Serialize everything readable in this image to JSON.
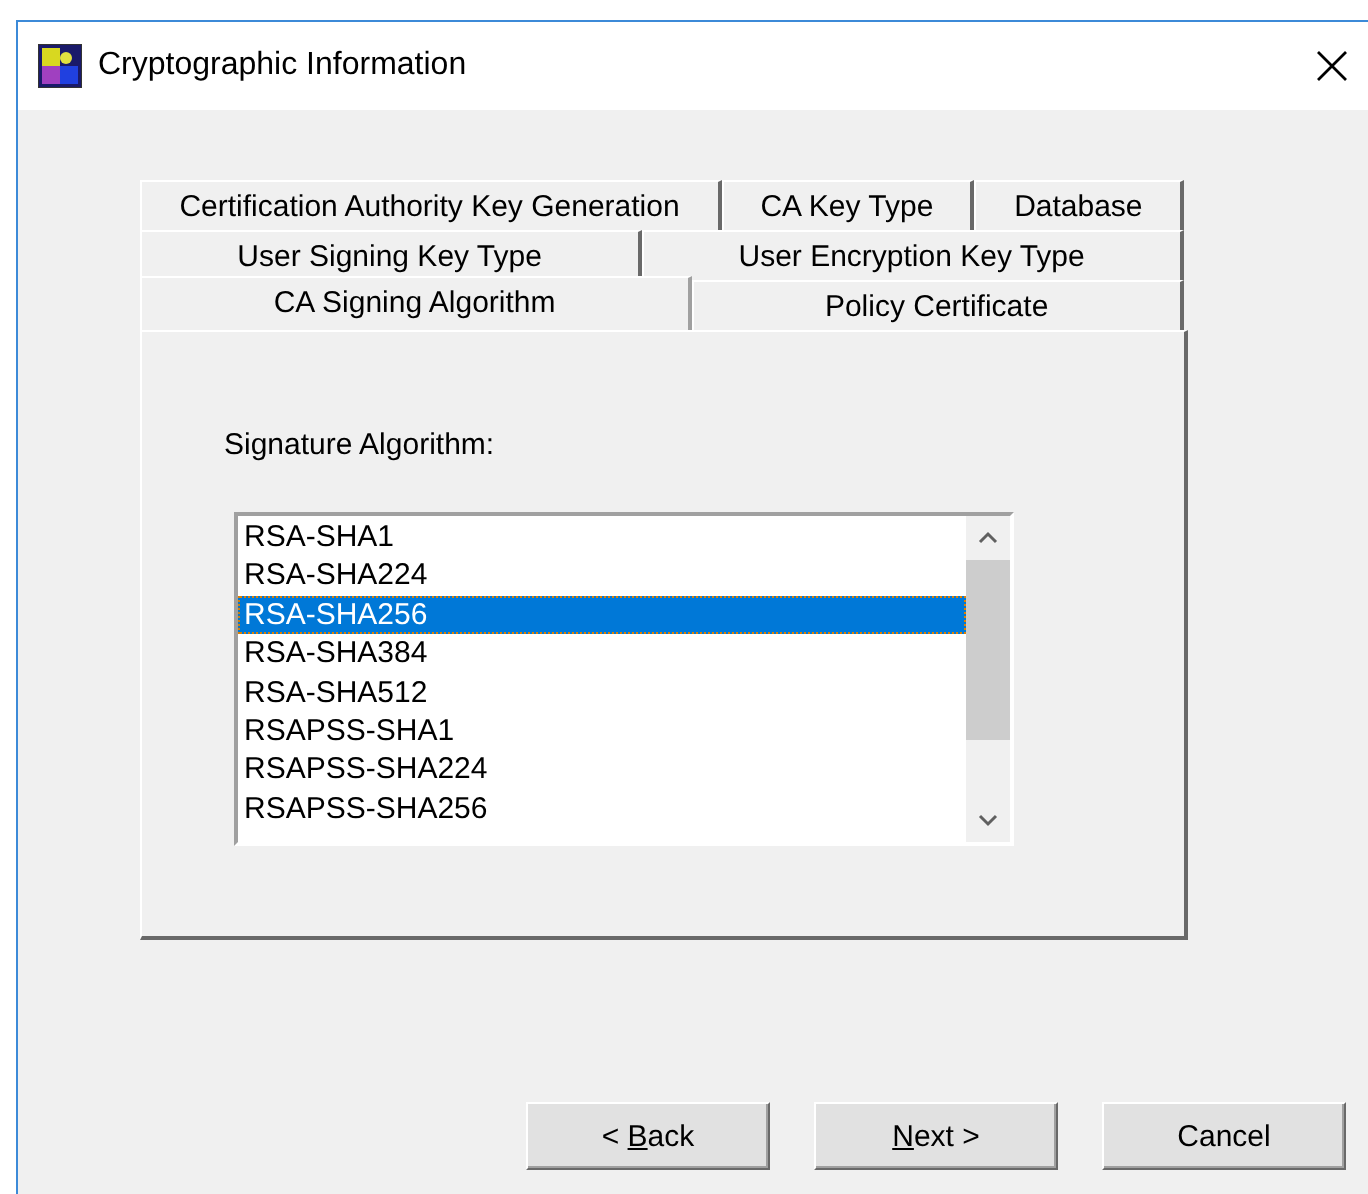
{
  "window": {
    "title": "Cryptographic Information"
  },
  "tab_rows": [
    [
      {
        "label": "Certification Authority Key Generation",
        "selected": false
      },
      {
        "label": "CA Key Type",
        "selected": false
      },
      {
        "label": "Database",
        "selected": false
      }
    ],
    [
      {
        "label": "User Signing Key Type",
        "selected": false
      },
      {
        "label": "User Encryption Key Type",
        "selected": false
      }
    ],
    [
      {
        "label": "CA Signing Algorithm",
        "selected": true
      },
      {
        "label": "Policy Certificate",
        "selected": false
      }
    ]
  ],
  "signature_algorithm": {
    "label": "Signature Algorithm:",
    "items": [
      {
        "label": "RSA-SHA1",
        "selected": false
      },
      {
        "label": "RSA-SHA224",
        "selected": false
      },
      {
        "label": "RSA-SHA256",
        "selected": true
      },
      {
        "label": "RSA-SHA384",
        "selected": false
      },
      {
        "label": "RSA-SHA512",
        "selected": false
      },
      {
        "label": "RSAPSS-SHA1",
        "selected": false
      },
      {
        "label": "RSAPSS-SHA224",
        "selected": false
      },
      {
        "label": "RSAPSS-SHA256",
        "selected": false
      }
    ]
  },
  "buttons": [
    {
      "before": "< ",
      "access_key": "B",
      "after": "ack"
    },
    {
      "access_key": "N",
      "after": "ext >"
    },
    {
      "before": "Cancel"
    }
  ]
}
